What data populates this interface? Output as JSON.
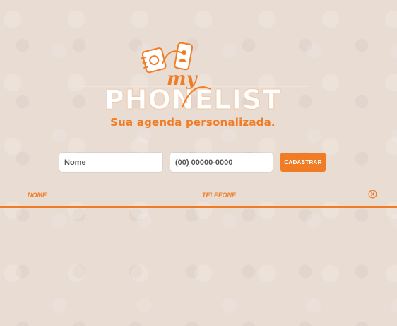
{
  "brand": {
    "logo_small": "my",
    "logo_main": "PHONELIST",
    "tagline": "Sua agenda personalizada.",
    "accent_color": "#f07d26"
  },
  "form": {
    "name_placeholder": "Nome",
    "phone_placeholder": "(00) 00000-0000",
    "submit_label": "CADASTRAR"
  },
  "table": {
    "columns": [
      "NOME",
      "TELEFONE"
    ],
    "clear_icon": "close-circle-icon",
    "rows": []
  }
}
